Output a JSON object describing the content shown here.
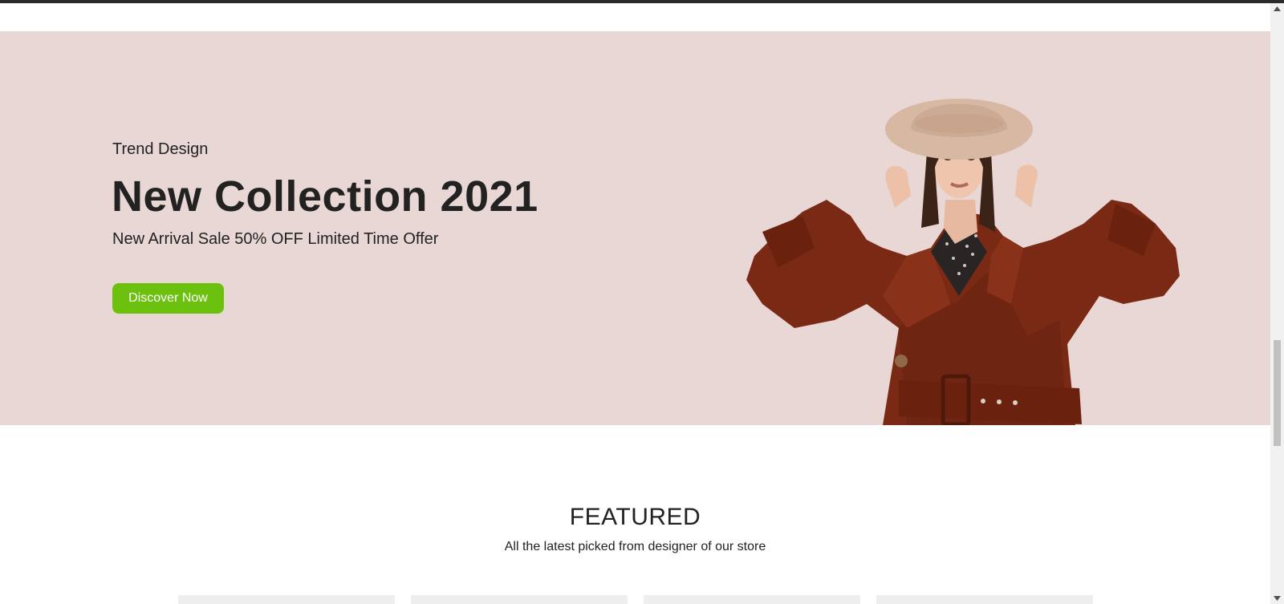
{
  "hero": {
    "eyebrow": "Trend Design",
    "title": "New Collection 2021",
    "subtitle": "New Arrival Sale 50% OFF Limited Time Offer",
    "cta_label": "Discover Now",
    "background_color": "#e8d7d4",
    "cta_color": "#6cc00e",
    "image_icon": "model-in-brown-trench-coat-and-hat"
  },
  "featured": {
    "title": "FEATURED",
    "subtitle": "All the latest picked from designer of our store",
    "cards": [
      {
        "name": "product-card-1"
      },
      {
        "name": "product-card-2"
      },
      {
        "name": "product-card-3"
      },
      {
        "name": "product-card-4"
      }
    ]
  },
  "scrollbar": {
    "up_icon": "chevron-up-icon",
    "down_icon": "chevron-down-icon"
  }
}
